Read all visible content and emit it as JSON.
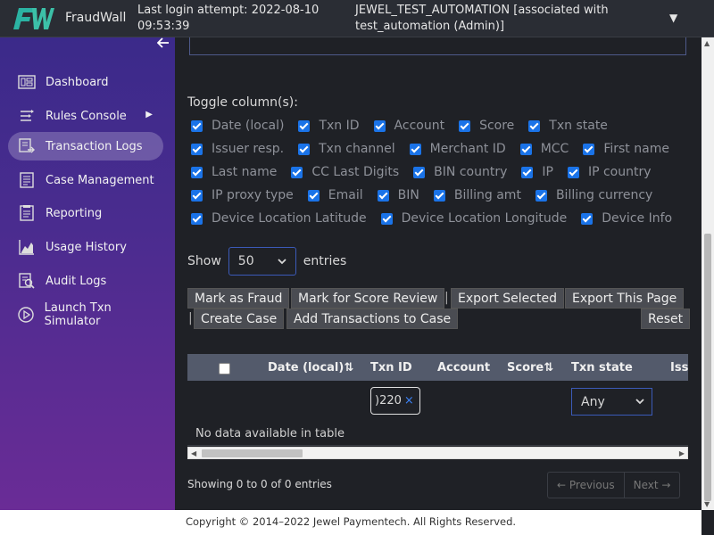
{
  "header": {
    "brand": "FraudWall",
    "login_info": "Last login attempt: 2022-08-10 09:53:39",
    "account": "JEWEL_TEST_AUTOMATION [associated with test_automation (Admin)]",
    "caret": "▼"
  },
  "sidebar": {
    "collapse": "🡐",
    "items": [
      {
        "label": "Dashboard",
        "icon": "dashboard-icon"
      },
      {
        "label": "Rules Console",
        "icon": "rules-icon",
        "arrow": "▶"
      },
      {
        "label": "Transaction Logs",
        "icon": "transaction-logs-icon",
        "active": true
      },
      {
        "label": "Case Management",
        "icon": "case-icon"
      },
      {
        "label": "Reporting",
        "icon": "reporting-icon"
      },
      {
        "label": "Usage History",
        "icon": "usage-chart-icon"
      },
      {
        "label": "Audit Logs",
        "icon": "audit-icon"
      },
      {
        "label": "Launch Txn Simulator",
        "icon": "play-icon"
      }
    ]
  },
  "toggle": {
    "title": "Toggle column(s):",
    "rows": [
      [
        "Date (local)",
        "Txn ID",
        "Account",
        "Score",
        "Txn state"
      ],
      [
        "Issuer resp.",
        "Txn channel",
        "Merchant ID",
        "MCC",
        "First name"
      ],
      [
        "Last name",
        "CC Last Digits",
        "BIN country",
        "IP",
        "IP country"
      ],
      [
        "IP proxy type",
        "Email",
        "BIN",
        "Billing amt",
        "Billing currency"
      ],
      [
        "Device Location Latitude",
        "Device Location Longitude",
        "Device Info"
      ]
    ]
  },
  "show": {
    "label": "Show",
    "value": "50",
    "suffix": "entries"
  },
  "actions": {
    "mark_fraud": "Mark as Fraud",
    "mark_score_review": "Mark for Score Review",
    "export_selected": "Export Selected",
    "export_page": "Export This Page",
    "create_case": "Create Case",
    "add_to_case": "Add Transactions to Case",
    "reset": "Reset",
    "pipe": "|"
  },
  "table": {
    "headers": {
      "date": "Date (local)⇅",
      "txn_id": "Txn ID",
      "account": "Account",
      "score": "Score⇅",
      "txn_state": "Txn state",
      "issuer": "Iss"
    },
    "filter_txn_id": ")220",
    "filter_clear": "×",
    "filter_state": "Any",
    "empty": "No data available in table"
  },
  "info": "Showing 0 to 0 of 0 entries",
  "pager": {
    "previous": "← Previous",
    "next": "Next →"
  },
  "footer": "Copyright © 2014–2022 Jewel Paymentech. All Rights Reserved.",
  "colors": {
    "sidebar_top": "#3b2a8a",
    "sidebar_bottom": "#6a2c96",
    "checkbox": "#1a73e8",
    "table_header": "#535a6b"
  }
}
